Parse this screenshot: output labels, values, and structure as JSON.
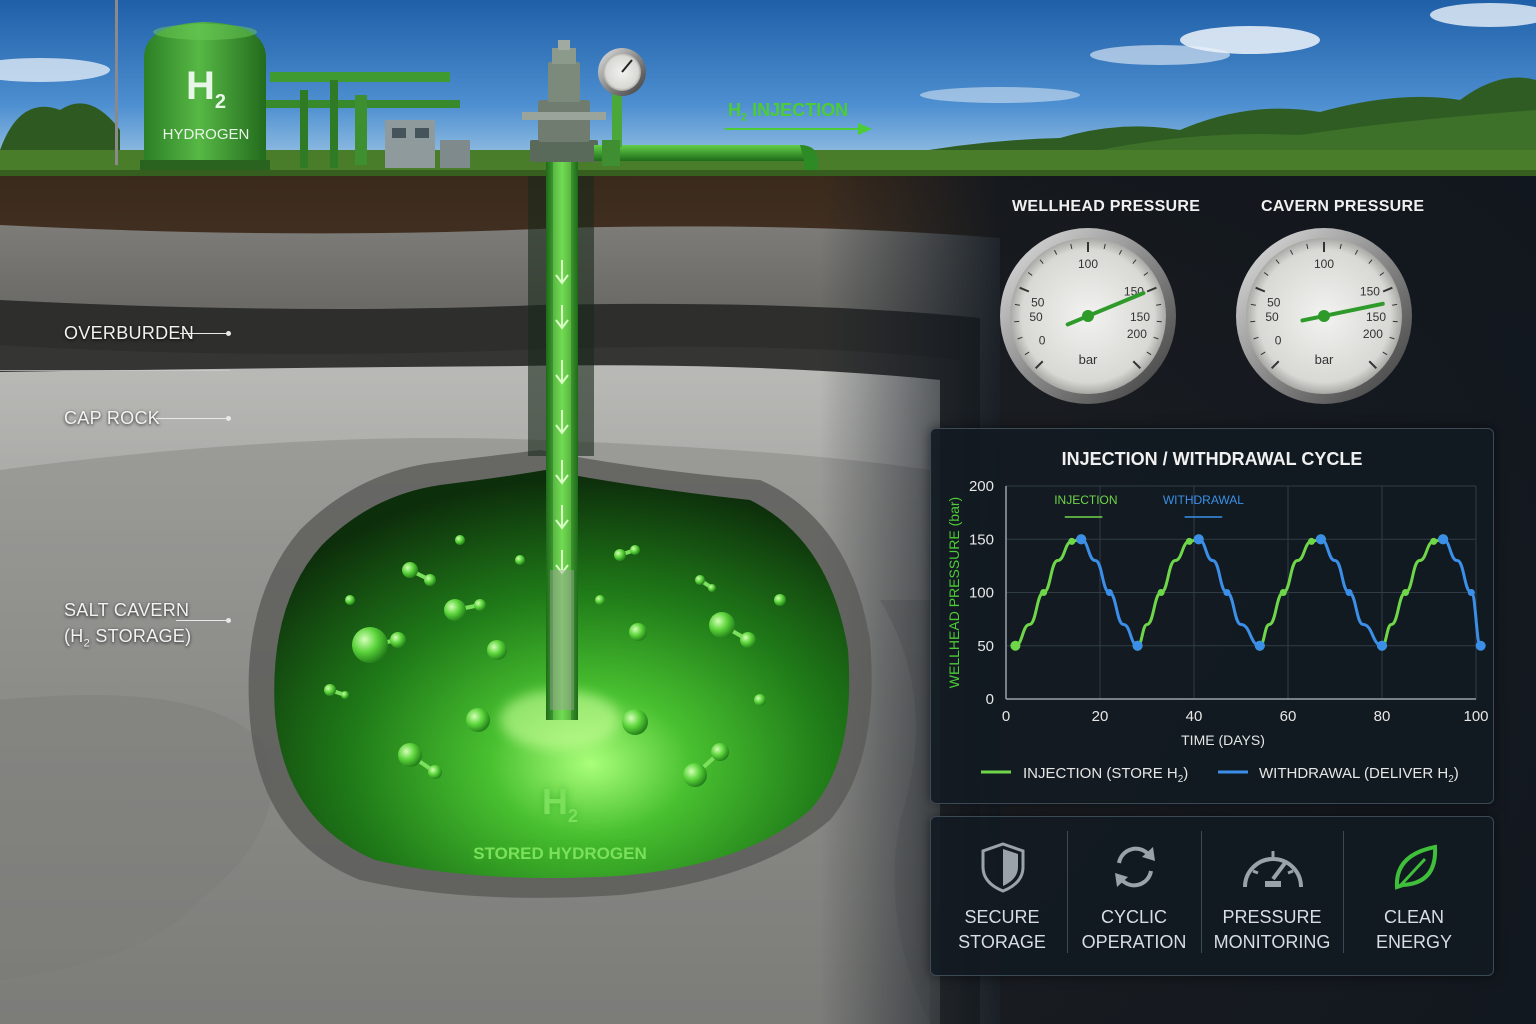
{
  "tank": {
    "formula": "H",
    "formula_sub": "2",
    "name": "HYDROGEN"
  },
  "injection_label": {
    "prefix": "H",
    "sub": "2",
    "text": " INJECTION"
  },
  "layers": {
    "overburden": "OVERBURDEN",
    "cap_rock": "CAP ROCK",
    "salt_cavern_line1": "SALT CAVERN",
    "salt_cavern_line2_pre": "(H",
    "salt_cavern_line2_sub": "2",
    "salt_cavern_line2_post": " STORAGE)"
  },
  "cavern": {
    "formula": "H",
    "formula_sub": "2",
    "caption": "STORED HYDROGEN"
  },
  "gauges": {
    "wellhead": {
      "title": "WELLHEAD PRESSURE",
      "unit": "bar",
      "value": 150,
      "ticks": [
        "0",
        "50",
        "100",
        "150",
        "200"
      ],
      "inner_ticks": [
        "50",
        "150"
      ]
    },
    "cavern": {
      "title": "CAVERN PRESSURE",
      "unit": "bar",
      "value": 158,
      "ticks": [
        "0",
        "50",
        "100",
        "150",
        "200"
      ],
      "inner_ticks": [
        "50",
        "150"
      ]
    }
  },
  "chart_data": {
    "type": "line",
    "title": "INJECTION / WITHDRAWAL CYCLE",
    "xlabel": "TIME (DAYS)",
    "ylabel": "WELLHEAD PRESSURE (bar)",
    "xlim": [
      0,
      100
    ],
    "ylim": [
      0,
      200
    ],
    "xticks": [
      0,
      20,
      40,
      60,
      80,
      100
    ],
    "yticks": [
      0,
      50,
      100,
      150,
      200
    ],
    "annotations": [
      {
        "text": "INJECTION",
        "color": "#6fd64a"
      },
      {
        "text": "WITHDRAWAL",
        "color": "#3b8fe8"
      }
    ],
    "legend": {
      "placement": "bottom",
      "injection": {
        "pre": "INJECTION (STORE H",
        "sub": "2",
        "post": ")"
      },
      "withdrawal": {
        "pre": "WITHDRAWAL (DELIVER H",
        "sub": "2",
        "post": ")"
      }
    },
    "series": [
      {
        "name": "INJECTION (STORE H2)",
        "color": "#6fd64a",
        "segments": [
          {
            "x": [
              2,
              5,
              8,
              11,
              14,
              16
            ],
            "y": [
              50,
              70,
              100,
              130,
              148,
              150
            ]
          },
          {
            "x": [
              28,
              30,
              33,
              36,
              39,
              41
            ],
            "y": [
              50,
              70,
              100,
              130,
              148,
              150
            ]
          },
          {
            "x": [
              54,
              56,
              59,
              62,
              65,
              67
            ],
            "y": [
              50,
              70,
              100,
              130,
              148,
              150
            ]
          },
          {
            "x": [
              80,
              82,
              85,
              88,
              91,
              93
            ],
            "y": [
              50,
              70,
              100,
              130,
              148,
              150
            ]
          }
        ]
      },
      {
        "name": "WITHDRAWAL (DELIVER H2)",
        "color": "#3b8fe8",
        "segments": [
          {
            "x": [
              16,
              19,
              22,
              25,
              28
            ],
            "y": [
              150,
              130,
              100,
              70,
              50
            ]
          },
          {
            "x": [
              41,
              44,
              47,
              50,
              54
            ],
            "y": [
              150,
              130,
              100,
              70,
              50
            ]
          },
          {
            "x": [
              67,
              70,
              73,
              76,
              80
            ],
            "y": [
              150,
              130,
              100,
              70,
              50
            ]
          },
          {
            "x": [
              93,
              96,
              99,
              101
            ],
            "y": [
              150,
              130,
              100,
              50
            ]
          }
        ]
      }
    ]
  },
  "features": [
    {
      "icon": "shield-icon",
      "line1": "SECURE",
      "line2": "STORAGE"
    },
    {
      "icon": "cycle-icon",
      "line1": "CYCLIC",
      "line2": "OPERATION"
    },
    {
      "icon": "gauge-icon",
      "line1": "PRESSURE",
      "line2": "MONITORING"
    },
    {
      "icon": "leaf-icon",
      "line1": "CLEAN",
      "line2": "ENERGY"
    }
  ]
}
